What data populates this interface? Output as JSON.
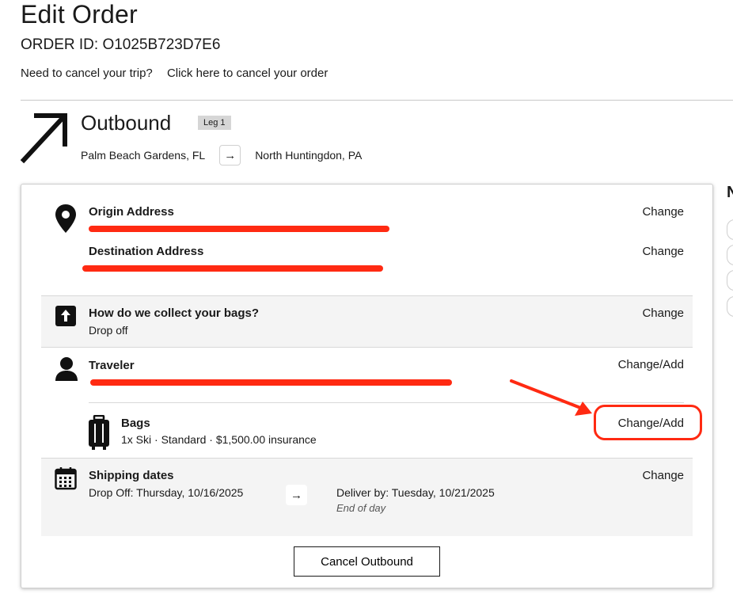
{
  "page": {
    "title": "Edit Order",
    "order_id": "ORDER ID: O1025B723D7E6",
    "cancel_prompt": "Need to cancel your trip?",
    "cancel_link": "Click here to cancel your order"
  },
  "leg": {
    "direction": "Outbound",
    "badge": "Leg 1",
    "from": "Palm Beach Gardens, FL",
    "to": "North Huntingdon, PA",
    "arrow_glyph": "→"
  },
  "address": {
    "origin_label": "Origin Address",
    "origin_change": "Change",
    "destination_label": "Destination Address",
    "destination_change": "Change"
  },
  "collection": {
    "label": "How do we collect your bags?",
    "value": "Drop off",
    "change": "Change"
  },
  "traveler": {
    "label": "Traveler",
    "change": "Change/Add"
  },
  "bags": {
    "label": "Bags",
    "value": "1x Ski · Standard · $1,500.00 insurance",
    "change": "Change/Add"
  },
  "shipping": {
    "label": "Shipping dates",
    "drop_off": "Drop Off: Thursday, 10/16/2025",
    "arrow_glyph": "→",
    "deliver_by": "Deliver by: Tuesday, 10/21/2025",
    "deliver_note": "End of day",
    "change": "Change"
  },
  "actions": {
    "cancel_outbound": "Cancel Outbound"
  },
  "peek": {
    "letter": "N"
  },
  "colors": {
    "annotation": "#ff2a12",
    "section_grey": "#f4f4f4",
    "text": "#1a1a1a"
  }
}
